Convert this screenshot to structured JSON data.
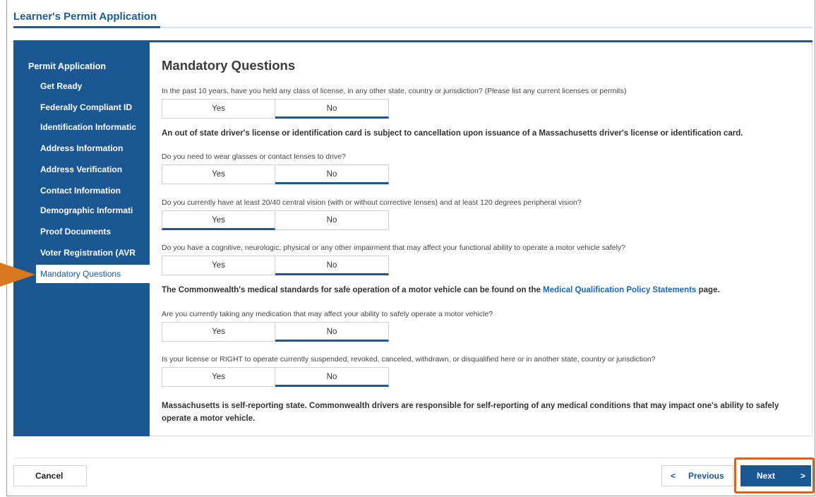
{
  "app": {
    "title": "Learner's Permit Application"
  },
  "sidebar": {
    "heading": "Permit Application",
    "items": [
      {
        "label": "Get Ready"
      },
      {
        "label": "Federally Compliant ID"
      },
      {
        "label": "Identification Informatic"
      },
      {
        "label": "Address Information"
      },
      {
        "label": "Address Verification"
      },
      {
        "label": "Contact Information"
      },
      {
        "label": "Demographic Informati"
      },
      {
        "label": "Proof Documents"
      },
      {
        "label": "Voter Registration (AVR"
      },
      {
        "label": "Mandatory Questions"
      }
    ],
    "active_index": 9
  },
  "main": {
    "title": "Mandatory Questions",
    "questions": [
      {
        "text": "In the past 10 years, have you held any class of license, in any other state, country or jurisdiction? (Please list any current licenses or permits)",
        "yes": "Yes",
        "no": "No",
        "selected": "No"
      },
      {
        "text": "Do you need to wear glasses or contact lenses to drive?",
        "yes": "Yes",
        "no": "No",
        "selected": "No"
      },
      {
        "text": "Do you currently have at least 20/40 central vision (with or without corrective lenses) and at least 120 degrees peripheral vision?",
        "yes": "Yes",
        "no": "No",
        "selected": "Yes"
      },
      {
        "text": "Do you have a cognitive, neurologic, physical or any other impairment that may affect your functional ability to operate a motor vehicle safely?",
        "yes": "Yes",
        "no": "No",
        "selected": "No"
      },
      {
        "text": "Are you currently taking any medication that may affect your ability to safely operate a motor vehicle?",
        "yes": "Yes",
        "no": "No",
        "selected": "No"
      },
      {
        "text": "Is your license or RIGHT to operate currently suspended, revoked, canceled, withdrawn, or disqualified here or in another state, country or jurisdiction?",
        "yes": "Yes",
        "no": "No",
        "selected": "No"
      }
    ],
    "notice_out_of_state": "An out of state driver's license or identification card is subject to cancellation upon issuance of a Massachusetts driver's license or identification card.",
    "notice_medical_prefix": "The Commonwealth's medical standards for safe operation of a motor vehicle can be found on the",
    "notice_medical_link": "Medical Qualification Policy Statements",
    "notice_medical_suffix": "page.",
    "notice_self_reporting": "Massachusetts is self-reporting state. Commonwealth drivers are responsible for self-reporting of any medical conditions that may impact one's ability to safely operate a motor vehicle."
  },
  "footer": {
    "cancel_label": "Cancel",
    "previous_label": "Previous",
    "next_label": "Next",
    "previous_chevron": "<",
    "next_chevron": ">"
  },
  "colors": {
    "brand": "#1b5793",
    "highlight": "#c8692b",
    "pointer": "#d9781f"
  }
}
